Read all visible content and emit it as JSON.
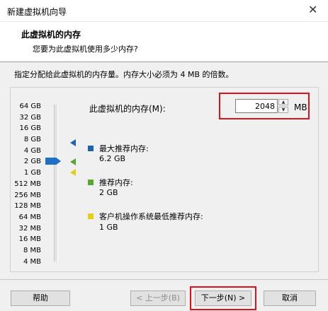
{
  "window": {
    "title": "新建虚拟机向导",
    "close_glyph": "✕"
  },
  "header": {
    "title": "此虚拟机的内存",
    "subtitle": "您要为此虚拟机使用多少内存?"
  },
  "instruction": "指定分配给此虚拟机的内存量。内存大小必须为 4 MB 的倍数。",
  "scale": [
    "64 GB",
    "32 GB",
    "16 GB",
    "8 GB",
    "4 GB",
    "2 GB",
    "1 GB",
    "512 MB",
    "256 MB",
    "128 MB",
    "64 MB",
    "32 MB",
    "16 MB",
    "8 MB",
    "4 MB"
  ],
  "slider": {
    "selected": "2 GB"
  },
  "memory": {
    "label": "此虚拟机的内存(M):",
    "value": "2048",
    "unit": "MB",
    "spin_up": "▲",
    "spin_down": "▼"
  },
  "legend": [
    {
      "title": "最大推荐内存:",
      "value": "6.2 GB",
      "color": "#1e62b0"
    },
    {
      "title": "推荐内存:",
      "value": "2 GB",
      "color": "#58a733"
    },
    {
      "title": "客户机操作系统最低推荐内存:",
      "value": "1 GB",
      "color": "#e6cf12"
    }
  ],
  "buttons": {
    "help": "帮助",
    "back": "< 上一步(B)",
    "next": "下一步(N) >",
    "cancel": "取消"
  }
}
